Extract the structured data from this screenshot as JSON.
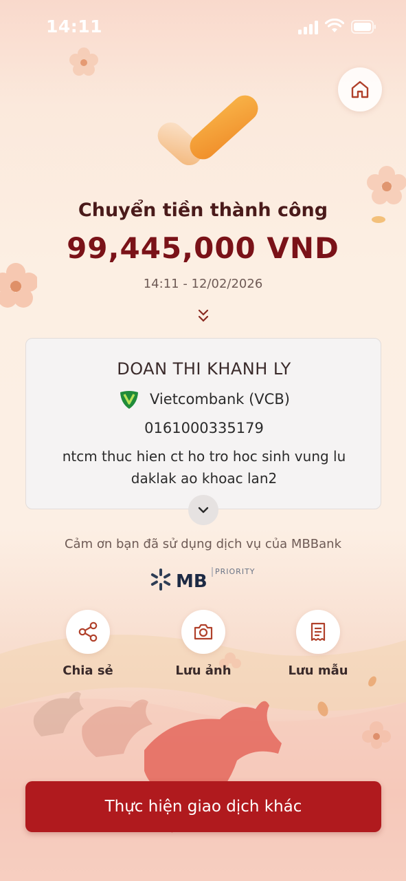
{
  "status_bar": {
    "time": "14:11",
    "icons": [
      "signal-icon",
      "wifi-icon",
      "battery-icon"
    ]
  },
  "header": {
    "home_icon": "home-icon"
  },
  "result": {
    "title": "Chuyển tiền thành công",
    "amount": "99,445,000 VND",
    "datetime": "14:11 - 12/02/2026"
  },
  "recipient": {
    "name": "DOAN THI KHANH LY",
    "bank_name": "Vietcombank (VCB)",
    "account_number": "0161000335179",
    "description": "ntcm thuc hien ct ho tro hoc sinh vung lu daklak ao khoac lan2"
  },
  "footer_note": "Cảm ơn bạn đã sử dụng dịch vụ của MBBank",
  "brand": {
    "logo_text": "MB",
    "tier": "PRIORITY"
  },
  "actions": [
    {
      "label": "Chia sẻ",
      "icon": "share-icon"
    },
    {
      "label": "Lưu ảnh",
      "icon": "camera-icon"
    },
    {
      "label": "Lưu mẫu",
      "icon": "receipt-icon"
    }
  ],
  "primary_button": "Thực hiện giao dịch khác",
  "colors": {
    "primary": "#b01a1e",
    "amount": "#7a1218",
    "check_accent": "#f5a33a",
    "vcb_green": "#1f8b3a"
  }
}
